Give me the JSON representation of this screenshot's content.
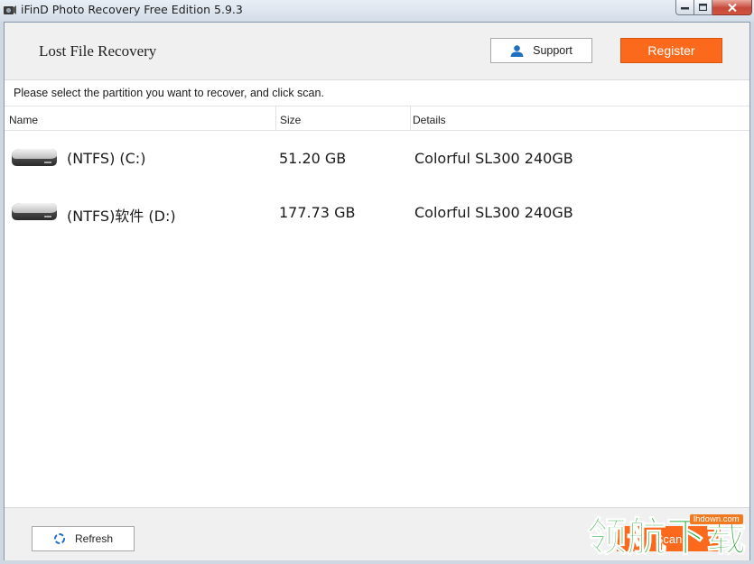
{
  "window": {
    "title": "iFinD Photo Recovery Free Edition 5.9.3"
  },
  "header": {
    "brand": "Lost File Recovery",
    "support_label": "Support",
    "register_label": "Register"
  },
  "instruction": "Please select the partition you want to recover, and click scan.",
  "table": {
    "columns": [
      "Name",
      "Size",
      "Details"
    ],
    "rows": [
      {
        "name": "(NTFS) (C:)",
        "size": "51.20 GB",
        "details": "Colorful  SL300 240GB"
      },
      {
        "name": "(NTFS)软件 (D:)",
        "size": "177.73 GB",
        "details": "Colorful  SL300 240GB"
      }
    ]
  },
  "footer": {
    "refresh_label": "Refresh",
    "scan_label": "Scan"
  },
  "watermark": {
    "text": "领航下载",
    "site": "lhdown.com"
  },
  "colors": {
    "accent": "#fb6a1c",
    "support_icon": "#1f6fc2"
  }
}
